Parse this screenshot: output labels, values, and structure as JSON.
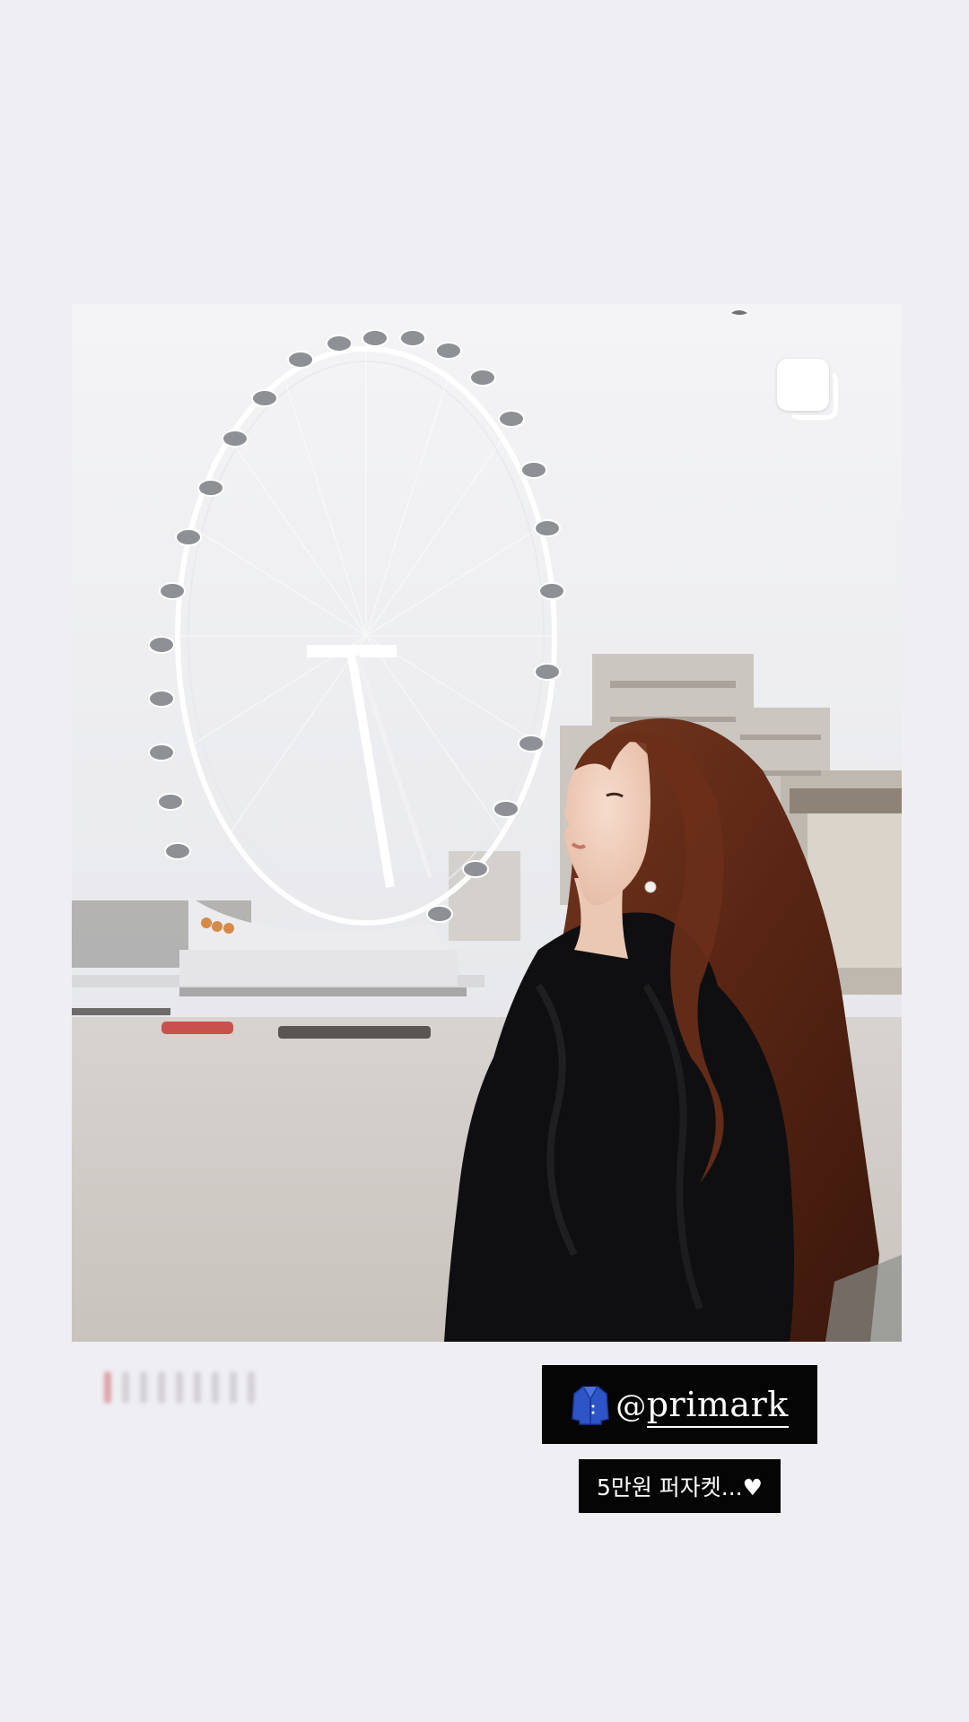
{
  "story": {
    "mention": {
      "icon": "coat-emoji",
      "at": "@",
      "handle": "primark"
    },
    "caption": "5만원 퍼자켓...♥",
    "photo": {
      "description_icon": "multiple-posts-icon"
    },
    "colors": {
      "background": "#efeef3",
      "sticker_bg": "#050505",
      "sticker_text": "#ffffff",
      "coat": "#2d55c8"
    }
  }
}
